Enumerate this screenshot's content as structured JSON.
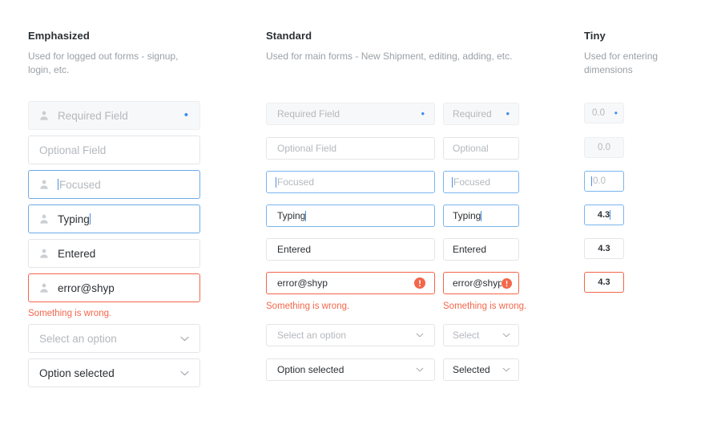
{
  "columns": [
    {
      "key": "emphasized",
      "title": "Emphasized",
      "description": "Used for logged out forms - signup, login, etc.",
      "fields": [
        {
          "name": "required-field",
          "state": "filled",
          "icon": "person-icon",
          "text": "Required Field",
          "text_type": "placeholder",
          "required_marker": "•"
        },
        {
          "name": "optional-field",
          "state": "default",
          "icon": null,
          "text": "Optional Field",
          "text_type": "placeholder"
        },
        {
          "name": "focused-field",
          "state": "focused",
          "icon": "person-icon",
          "text": "Focused",
          "text_type": "placeholder",
          "cursor": "leading"
        },
        {
          "name": "typing-field",
          "state": "focused",
          "icon": "person-icon",
          "text": "Typing",
          "text_type": "value",
          "cursor": "trailing"
        },
        {
          "name": "entered-field",
          "state": "default",
          "icon": "person-icon",
          "text": "Entered",
          "text_type": "value"
        },
        {
          "name": "error-field",
          "state": "error",
          "icon": "person-icon",
          "text": "error@shyp",
          "text_type": "value",
          "error_message": "Something is wrong."
        },
        {
          "name": "select-placeholder",
          "state": "default",
          "icon": null,
          "text": "Select an option",
          "text_type": "placeholder",
          "control": "select"
        },
        {
          "name": "select-chosen",
          "state": "default",
          "icon": null,
          "text": "Option selected",
          "text_type": "value",
          "control": "select"
        }
      ]
    },
    {
      "key": "standard",
      "title": "Standard",
      "description": "Used for main forms - New Shipment, editing, adding, etc.",
      "fields": [
        {
          "name": "required-field",
          "state": "filled",
          "text": "Required Field",
          "text_type": "placeholder",
          "required_marker": "•"
        },
        {
          "name": "optional-field",
          "state": "default",
          "text": "Optional Field",
          "text_type": "placeholder"
        },
        {
          "name": "focused-field",
          "state": "focused",
          "text": "Focused",
          "text_type": "placeholder",
          "cursor": "leading"
        },
        {
          "name": "typing-field",
          "state": "focused",
          "text": "Typing",
          "text_type": "value",
          "cursor": "trailing"
        },
        {
          "name": "entered-field",
          "state": "default",
          "text": "Entered",
          "text_type": "value"
        },
        {
          "name": "error-field",
          "state": "error",
          "text": "error@shyp",
          "text_type": "value",
          "error_icon": "error-exclamation-icon",
          "error_message": "Something is wrong."
        },
        {
          "name": "select-placeholder",
          "state": "default",
          "text": "Select an option",
          "text_type": "placeholder",
          "control": "select"
        },
        {
          "name": "select-chosen",
          "state": "default",
          "text": "Option selected",
          "text_type": "value",
          "control": "select"
        }
      ],
      "narrow_fields": [
        {
          "name": "required-field-narrow",
          "state": "filled",
          "text": "Required",
          "text_type": "placeholder",
          "required_marker": "•"
        },
        {
          "name": "optional-field-narrow",
          "state": "default",
          "text": "Optional",
          "text_type": "placeholder"
        },
        {
          "name": "focused-field-narrow",
          "state": "focused",
          "text": "Focused",
          "text_type": "placeholder",
          "cursor": "leading"
        },
        {
          "name": "typing-field-narrow",
          "state": "focused",
          "text": "Typing",
          "text_type": "value",
          "cursor": "trailing"
        },
        {
          "name": "entered-field-narrow",
          "state": "default",
          "text": "Entered",
          "text_type": "value"
        },
        {
          "name": "error-field-narrow",
          "state": "error",
          "text": "error@shyp",
          "text_type": "value",
          "error_icon": "error-exclamation-icon",
          "error_message": "Something is wrong."
        },
        {
          "name": "select-placeholder-narrow",
          "state": "default",
          "text": "Select",
          "text_type": "placeholder",
          "control": "select"
        },
        {
          "name": "select-chosen-narrow",
          "state": "default",
          "text": "Selected",
          "text_type": "value",
          "control": "select"
        }
      ]
    },
    {
      "key": "tiny",
      "title": "Tiny",
      "description": "Used for entering dimensions",
      "fields": [
        {
          "name": "required-field-tiny",
          "state": "filled",
          "text": "0.0",
          "text_type": "placeholder",
          "required_marker": "•"
        },
        {
          "name": "optional-field-tiny",
          "state": "filled",
          "text": "0.0",
          "text_type": "placeholder"
        },
        {
          "name": "focused-field-tiny",
          "state": "focused",
          "text": "0.0",
          "text_type": "placeholder",
          "cursor": "leading"
        },
        {
          "name": "typing-field-tiny",
          "state": "focused",
          "text": "4.3",
          "text_type": "value",
          "cursor": "trailing"
        },
        {
          "name": "entered-field-tiny",
          "state": "default",
          "text": "4.3",
          "text_type": "value"
        },
        {
          "name": "error-field-tiny",
          "state": "error",
          "text": "4.3",
          "text_type": "value"
        }
      ]
    }
  ],
  "colors": {
    "accent_blue": "#3b8df0",
    "focus_blue": "#7ab5ef",
    "error_red": "#f4664a",
    "text_dark": "#2b2f33",
    "text_muted": "#9aa0a6",
    "placeholder": "#b4b8bd",
    "border": "#e3e5e8",
    "fill": "#f7f8f9"
  }
}
